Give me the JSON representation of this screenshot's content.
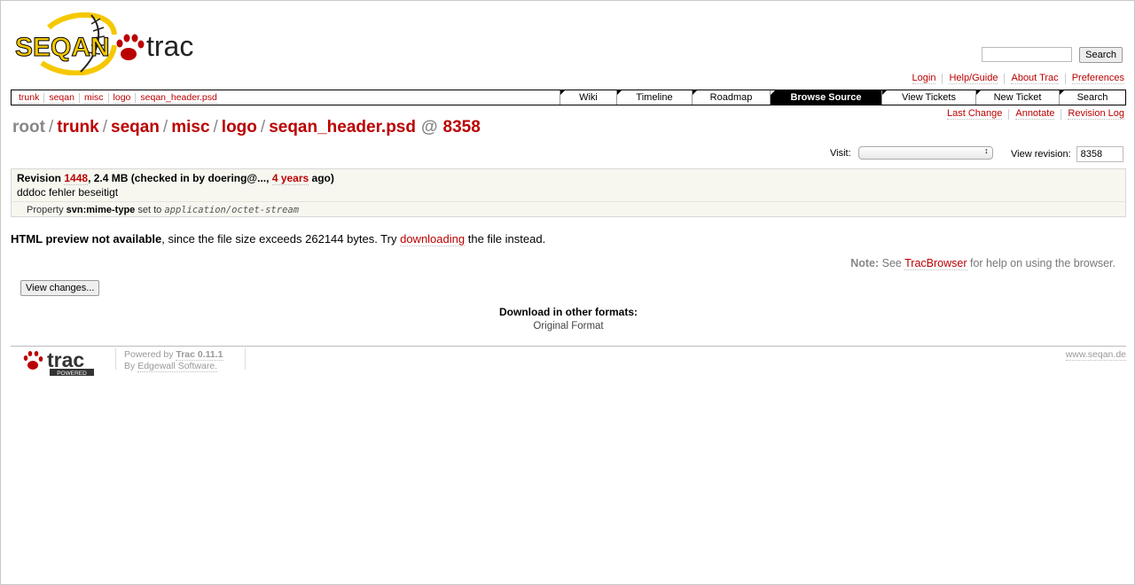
{
  "logo": {
    "text_seqan": "SEQAN",
    "text_trac": "trac"
  },
  "search": {
    "placeholder": "",
    "button": "Search"
  },
  "metanav": [
    "Login",
    "Help/Guide",
    "About Trac",
    "Preferences"
  ],
  "breadcrumbs": [
    "trunk",
    "seqan",
    "misc",
    "logo",
    "seqan_header.psd"
  ],
  "mainnav": [
    {
      "label": "Wiki",
      "active": false
    },
    {
      "label": "Timeline",
      "active": false
    },
    {
      "label": "Roadmap",
      "active": false
    },
    {
      "label": "Browse Source",
      "active": true
    },
    {
      "label": "View Tickets",
      "active": false
    },
    {
      "label": "New Ticket",
      "active": false
    },
    {
      "label": "Search",
      "active": false
    }
  ],
  "ctxtnav": [
    "Last Change",
    "Annotate",
    "Revision Log"
  ],
  "path": {
    "root": "root",
    "segments": [
      "trunk",
      "seqan",
      "misc",
      "logo",
      "seqan_header.psd"
    ],
    "at": "@",
    "revision": "8358"
  },
  "visit": {
    "label": "Visit:",
    "value": ""
  },
  "view_revision": {
    "label": "View revision:",
    "value": "8358"
  },
  "info": {
    "revision_label": "Revision",
    "revision": "1448",
    "size_text": ", 2.4 MB (checked in by doering@..., ",
    "age": "4 years",
    "age_suffix": " ago)",
    "message": "dddoc fehler beseitigt",
    "prop_prefix": "Property",
    "prop_name": "svn:mime-type",
    "prop_mid": "set to",
    "prop_value": "application/octet-stream"
  },
  "preview": {
    "bold": "HTML preview not available",
    "text": ", since the file size exceeds 262144 bytes. Try",
    "link": "downloading",
    "suffix": "the file instead."
  },
  "note": {
    "label": "Note:",
    "pre": "See",
    "link": "TracBrowser",
    "post": "for help on using the browser."
  },
  "view_changes_button": "View changes...",
  "altlinks": {
    "heading": "Download in other formats:",
    "format": "Original Format"
  },
  "footer": {
    "powered_pre": "Powered by",
    "trac_version": "Trac 0.11.1",
    "by": "By",
    "company": "Edgewall Software.",
    "site": "www.seqan.de",
    "badge_word": "trac",
    "badge_sub": "POWERED"
  },
  "colors": {
    "link": "#bb0000",
    "active_tab_bg": "#000000",
    "logo_yellow": "#f5c800",
    "paw": "#bb0000"
  }
}
